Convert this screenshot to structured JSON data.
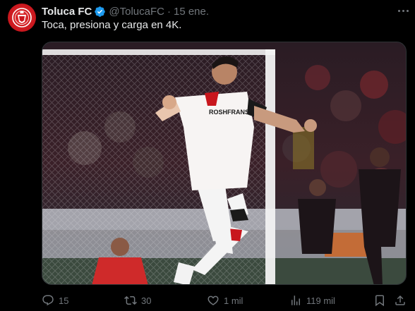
{
  "tweet": {
    "author_name": "Toluca FC",
    "handle": "@TolucaFC",
    "separator": "·",
    "date": "15 ene.",
    "text": "Toca, presiona y carga en 4K.",
    "image_jersey_text": "ROSHFRANS"
  },
  "actions": {
    "replies": "15",
    "retweets": "30",
    "likes": "1 mil",
    "views": "119 mil"
  },
  "colors": {
    "background": "#000000",
    "primary_text": "#e7e9ea",
    "secondary_text": "#71767b",
    "verified_blue": "#1d9bf0",
    "brand_red": "#c8161d"
  },
  "icons": {
    "avatar": "toluca-crest-icon",
    "verified": "verified-badge-icon",
    "more": "more-options-icon",
    "reply": "reply-icon",
    "retweet": "retweet-icon",
    "like": "heart-icon",
    "views": "views-icon",
    "bookmark": "bookmark-icon",
    "share": "share-icon"
  }
}
